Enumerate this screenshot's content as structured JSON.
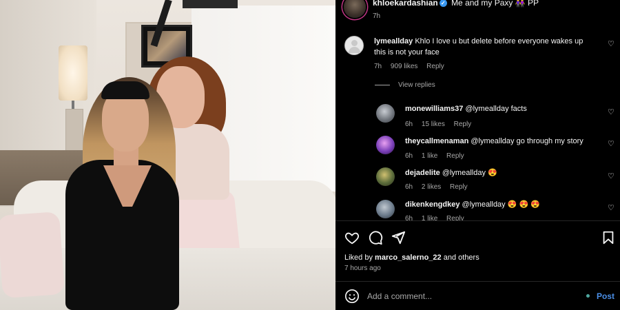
{
  "post": {
    "username": "khloekardashian",
    "caption": "Me and my Paxy 👭 PP",
    "time_ago": "7h"
  },
  "comments": [
    {
      "username": "lymeallday",
      "text": "Khlo I love u but delete before everyone wakes up this is not your face",
      "time_ago": "7h",
      "likes": "909 likes",
      "reply_label": "Reply"
    }
  ],
  "view_replies_label": "View replies",
  "replies": [
    {
      "username": "monewilliams37",
      "text": "@lymeallday facts",
      "time_ago": "6h",
      "likes": "15 likes",
      "reply_label": "Reply",
      "avatar_color": "#8a8f96"
    },
    {
      "username": "theycallmenaman",
      "text": "@lymeallday go through my story",
      "time_ago": "6h",
      "likes": "1 like",
      "reply_label": "Reply",
      "avatar_color": "#7a3fb8"
    },
    {
      "username": "dejadelite",
      "text": "@lymeallday 😍",
      "time_ago": "6h",
      "likes": "2 likes",
      "reply_label": "Reply",
      "avatar_color": "#5a6b3a"
    },
    {
      "username": "dikenkengdkey",
      "text": "@lymeallday 😍 😍 😍",
      "time_ago": "6h",
      "likes": "1 like",
      "reply_label": "Reply",
      "avatar_color": "#6b7a8a"
    }
  ],
  "actions": {
    "liked_by_prefix": "Liked by",
    "liked_by_user": "marco_salerno_22",
    "liked_by_suffix": "and others",
    "posted_time": "7 hours ago"
  },
  "comment_box": {
    "placeholder": "Add a comment...",
    "post_label": "Post"
  },
  "icons": {
    "like": "heart-outline-icon",
    "comment": "comment-bubble-icon",
    "share": "paper-plane-icon",
    "save": "bookmark-icon",
    "emoji": "smiley-icon",
    "verified": "verified-badge-icon"
  },
  "colors": {
    "background": "#000000",
    "secondary_text": "#a8a8a8",
    "verified": "#3897f0",
    "post_button": "#4a8ee6"
  }
}
